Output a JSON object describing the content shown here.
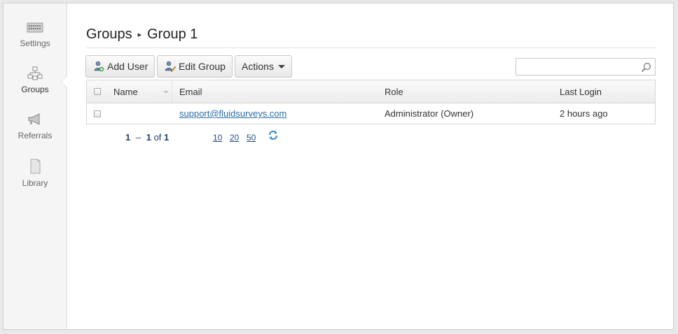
{
  "sidebar": {
    "items": [
      {
        "label": "Settings",
        "icon": "keyboard-icon",
        "active": false
      },
      {
        "label": "Groups",
        "icon": "hierarchy-icon",
        "active": true
      },
      {
        "label": "Referrals",
        "icon": "megaphone-icon",
        "active": false
      },
      {
        "label": "Library",
        "icon": "document-icon",
        "active": false
      }
    ]
  },
  "breadcrumb": {
    "root": "Groups",
    "separator": "▸",
    "current": "Group 1"
  },
  "toolbar": {
    "add_user_label": "Add User",
    "edit_group_label": "Edit Group",
    "actions_label": "Actions"
  },
  "search": {
    "value": "",
    "placeholder": ""
  },
  "table": {
    "columns": [
      "Name",
      "Email",
      "Role",
      "Last Login"
    ],
    "rows": [
      {
        "name": "",
        "email": "support@fluidsurveys.com",
        "role": "Administrator (Owner)",
        "last_login": "2 hours ago"
      }
    ]
  },
  "pagination": {
    "from": "1",
    "dash": "–",
    "to": "1",
    "of_label": "of",
    "total": "1",
    "page_sizes": [
      "10",
      "20",
      "50"
    ]
  },
  "colors": {
    "link": "#2a6ea8",
    "pager": "#1f3f6e",
    "sidebar_bg": "#f5f5f5"
  }
}
